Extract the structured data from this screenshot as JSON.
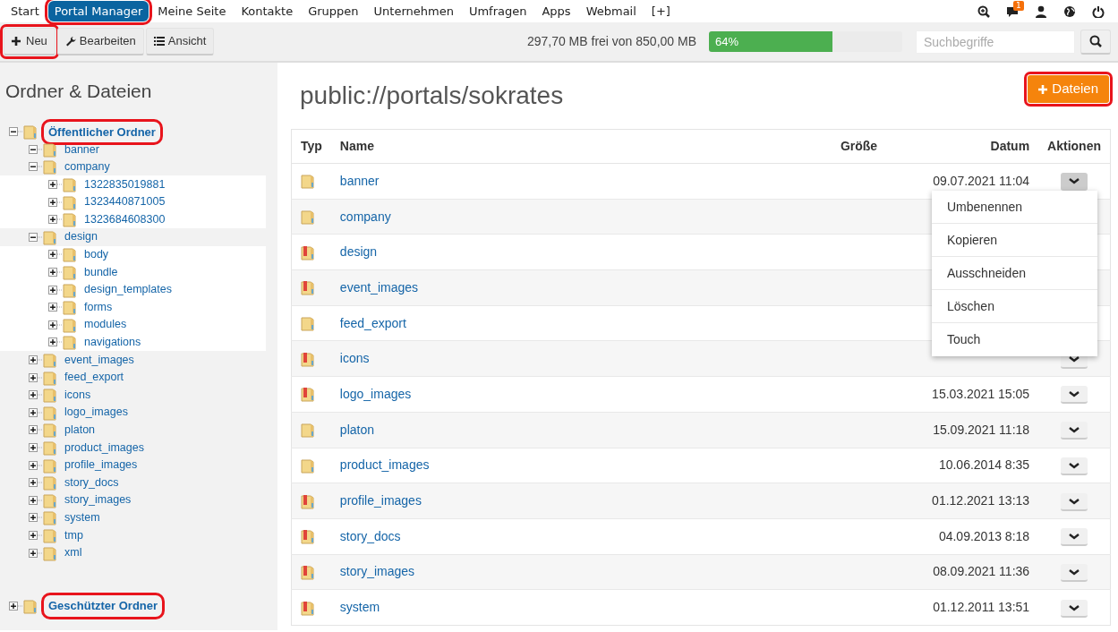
{
  "top_nav": {
    "items": [
      {
        "label": "Start",
        "selected": false,
        "annotated": false
      },
      {
        "label": "Portal Manager",
        "selected": true,
        "annotated": true
      },
      {
        "label": "Meine Seite",
        "selected": false,
        "annotated": false
      },
      {
        "label": "Kontakte",
        "selected": false,
        "annotated": false
      },
      {
        "label": "Gruppen",
        "selected": false,
        "annotated": false
      },
      {
        "label": "Unternehmen",
        "selected": false,
        "annotated": false
      },
      {
        "label": "Umfragen",
        "selected": false,
        "annotated": false
      },
      {
        "label": "Apps",
        "selected": false,
        "annotated": false
      },
      {
        "label": "Webmail",
        "selected": false,
        "annotated": false
      },
      {
        "label": "[+]",
        "selected": false,
        "annotated": false
      }
    ],
    "icons": [
      {
        "kind": "zoom"
      },
      {
        "kind": "messages",
        "badge": "1"
      },
      {
        "kind": "user"
      },
      {
        "kind": "globe"
      },
      {
        "kind": "power"
      }
    ]
  },
  "toolbar": {
    "buttons": [
      {
        "label": "Neu",
        "kind": "plus",
        "annotated": true
      },
      {
        "label": "Bearbeiten",
        "kind": "wrench",
        "annotated": false
      },
      {
        "label": "Ansicht",
        "kind": "list",
        "annotated": false
      }
    ],
    "storage": {
      "text": "297,70 MB frei von 850,00 MB",
      "level": 0.64,
      "reading": "64%"
    },
    "search": {
      "placeholder": "Suchbegriffe"
    }
  },
  "sidebar": {
    "title": "Ordner & Dateien",
    "roots": [
      {
        "label": "Öffentlicher Ordner",
        "expanded": true,
        "annotated": true,
        "children": [
          {
            "label": "banner",
            "expanded": true
          },
          {
            "label": "company",
            "expanded": true,
            "children": [
              {
                "label": "1322835019881",
                "expanded": false
              },
              {
                "label": "1323440871005",
                "expanded": false
              },
              {
                "label": "1323684608300",
                "expanded": false
              }
            ]
          },
          {
            "label": "design",
            "expanded": true,
            "children": [
              {
                "label": "body",
                "expanded": false
              },
              {
                "label": "bundle",
                "expanded": false
              },
              {
                "label": "design_templates",
                "expanded": false
              },
              {
                "label": "forms",
                "expanded": false
              },
              {
                "label": "modules",
                "expanded": false
              },
              {
                "label": "navigations",
                "expanded": false
              }
            ]
          },
          {
            "label": "event_images",
            "expanded": false
          },
          {
            "label": "feed_export",
            "expanded": false
          },
          {
            "label": "icons",
            "expanded": false
          },
          {
            "label": "logo_images",
            "expanded": false
          },
          {
            "label": "platon",
            "expanded": false
          },
          {
            "label": "product_images",
            "expanded": false
          },
          {
            "label": "profile_images",
            "expanded": false
          },
          {
            "label": "story_docs",
            "expanded": false
          },
          {
            "label": "story_images",
            "expanded": false
          },
          {
            "label": "system",
            "expanded": false
          },
          {
            "label": "tmp",
            "expanded": false
          },
          {
            "label": "xml",
            "expanded": false
          }
        ]
      },
      {
        "label": "Geschützter Ordner",
        "expanded": false,
        "annotated": true
      }
    ]
  },
  "main": {
    "path": "public://portals/sokrates",
    "add_button": {
      "label": "Dateien",
      "annotated": true
    },
    "table": {
      "columns": [
        "Typ",
        "Name",
        "Größe",
        "Datum",
        "Aktionen"
      ],
      "rows": [
        {
          "name": "banner",
          "restricted": false,
          "date": "09.07.2021 11:04",
          "menu_open": true
        },
        {
          "name": "company",
          "restricted": false,
          "hidden_actions": true
        },
        {
          "name": "design",
          "restricted": true,
          "hidden_actions": true
        },
        {
          "name": "event_images",
          "restricted": true,
          "hidden_actions": true
        },
        {
          "name": "feed_export",
          "restricted": false,
          "hidden_actions": true
        },
        {
          "name": "icons",
          "restricted": true
        },
        {
          "name": "logo_images",
          "restricted": true,
          "date": "15.03.2021 15:05"
        },
        {
          "name": "platon",
          "restricted": false,
          "date": "15.09.2021 11:18"
        },
        {
          "name": "product_images",
          "restricted": false,
          "date": "10.06.2014 8:35"
        },
        {
          "name": "profile_images",
          "restricted": true,
          "date": "01.12.2021 13:13"
        },
        {
          "name": "story_docs",
          "restricted": true,
          "date": "04.09.2013 8:18"
        },
        {
          "name": "story_images",
          "restricted": true,
          "date": "08.09.2021 11:36"
        },
        {
          "name": "system",
          "restricted": true,
          "date": "01.12.2011 13:51"
        }
      ]
    },
    "action_menu": [
      "Umbenennen",
      "Kopieren",
      "Ausschneiden",
      "Löschen",
      "Touch"
    ]
  }
}
